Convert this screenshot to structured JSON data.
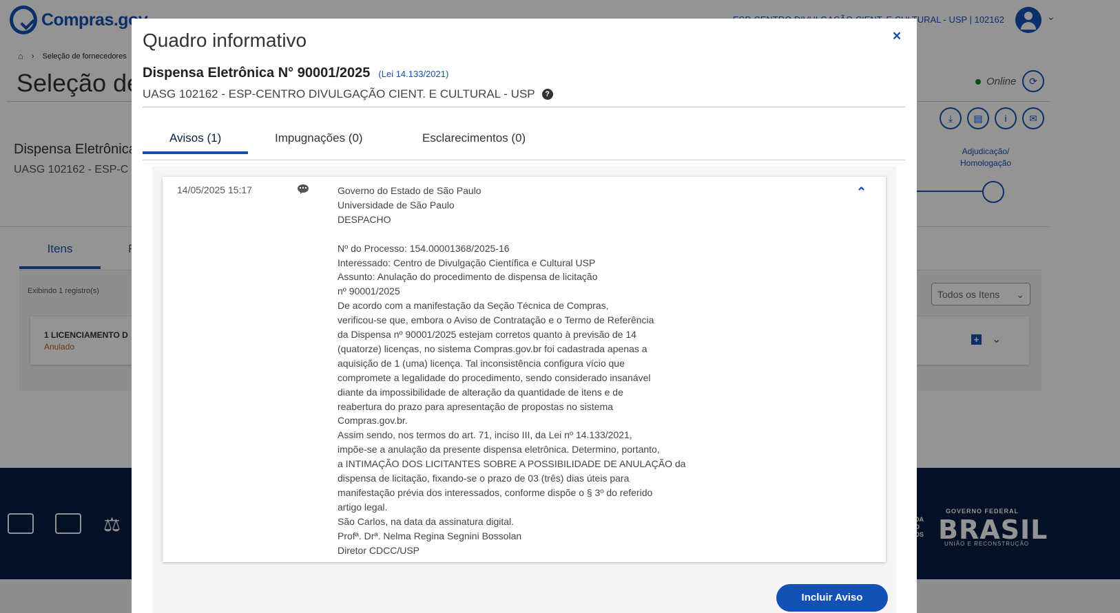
{
  "background": {
    "logo_text": "Compras.gov",
    "uasg_top": "ESP-CENTRO DIVULGAÇÃO CIENT. E CULTURAL - USP | 102162",
    "breadcrumb": [
      "Seleção de fornecedores"
    ],
    "page_title": "Seleção de",
    "online_label": "Online",
    "dispensa_title": "Dispensa Eletrônica",
    "uasg_label": "UASG 102162 - ESP-C",
    "stage_label_1": "Adjudicação/",
    "stage_label_2": "Homologação",
    "tab_itens": "Itens",
    "tab_partial": "F",
    "exibindo": "Exibindo 1 registro(s)",
    "filter_value": "Todos os Itens",
    "item_title": "1   LICENCIAMENTO D",
    "item_status": "Anulado",
    "footer_small": "GOVERNO FEDERAL",
    "footer_brand": "BRASIL",
    "footer_sub": "UNIÃO E RECONSTRUÇÃO",
    "footer_da_1": "DA",
    "footer_da_2": "O",
    "footer_da_3": "OS"
  },
  "modal": {
    "title": "Quadro informativo",
    "close_label": "×",
    "dispensa": "Dispensa Eletrônica N° 90001/2025",
    "lei": "(Lei 14.133/2021)",
    "uasg": "UASG 102162 - ESP-CENTRO DIVULGAÇÃO CIENT. E CULTURAL - USP",
    "help_icon": "?",
    "tabs": [
      {
        "label": "Avisos (1)",
        "active": true
      },
      {
        "label": "Impugnações (0)",
        "active": false
      },
      {
        "label": "Esclarecimentos (0)",
        "active": false
      }
    ],
    "aviso": {
      "date": "14/05/2025 15:17",
      "icon": "chat-icon",
      "lines": [
        "Governo do Estado de São Paulo",
        "Universidade de São Paulo",
        "DESPACHO",
        "",
        "Nº do Processo: 154.00001368/2025-16",
        "Interessado: Centro de Divulgação Científica e Cultural USP",
        "Assunto: Anulação do procedimento de dispensa de licitação",
        "nº 90001/2025",
        "De acordo com a manifestação da Seção Técnica de Compras,",
        "verificou-se que, embora o Aviso de Contratação e o Termo de Referência",
        "da Dispensa nº 90001/2025 estejam corretos quanto à previsão de 14",
        "(quatorze) licenças, no sistema Compras.gov.br foi cadastrada apenas a",
        "aquisição de 1 (uma) licença. Tal inconsistência configura vício que",
        "compromete a legalidade do procedimento, sendo considerado insanável",
        "diante da impossibilidade de alteração da quantidade de itens e de",
        "reabertura do prazo para apresentação de propostas no sistema",
        "Compras.gov.br.",
        "Assim sendo, nos termos do art. 71, inciso III, da Lei nº 14.133/2021,",
        "impõe-se a anulação da presente dispensa eletrônica. Determino, portanto,",
        "a INTIMAÇÃO DOS LICITANTES SOBRE A POSSIBILIDADE DE ANULAÇÃO da",
        "dispensa de licitação, fixando-se o prazo de 03 (três) dias úteis para",
        "manifestação prévia dos interessados, conforme dispõe o § 3º do referido",
        "artigo legal.",
        "São Carlos, na data da assinatura digital.",
        "Profª. Drª. Nelma Regina Segnini Bossolan",
        "Diretor CDCC/USP"
      ]
    },
    "incluir_button": "Incluir Aviso"
  },
  "colors": {
    "primary": "#1351b4",
    "footer": "#071d41",
    "status_anulado": "#c45a1c",
    "online": "#168821"
  }
}
